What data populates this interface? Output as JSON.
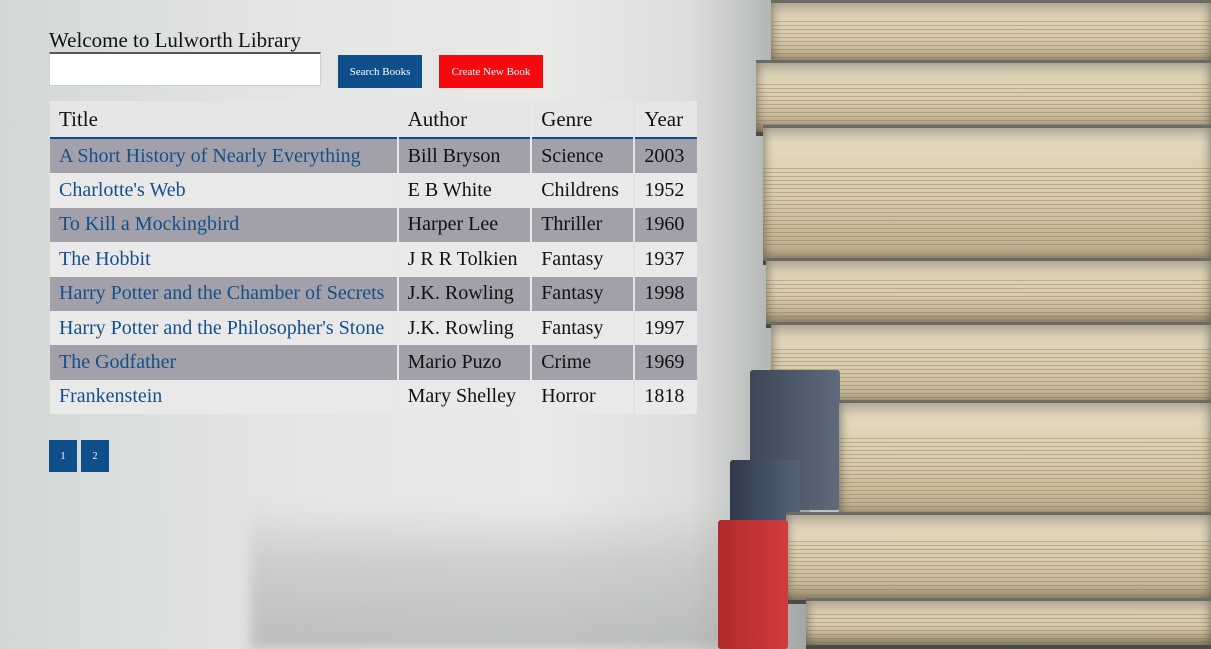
{
  "header": {
    "welcome": "Welcome to Lulworth Library"
  },
  "search": {
    "value": "",
    "placeholder": ""
  },
  "buttons": {
    "search_label": "Search Books",
    "create_label": "Create New Book"
  },
  "table": {
    "columns": [
      "Title",
      "Author",
      "Genre",
      "Year"
    ],
    "rows": [
      {
        "title": "A Short History of Nearly Everything",
        "author": "Bill Bryson",
        "genre": "Science",
        "year": "2003"
      },
      {
        "title": "Charlotte's Web",
        "author": "E B White",
        "genre": "Childrens",
        "year": "1952"
      },
      {
        "title": "To Kill a Mockingbird",
        "author": "Harper Lee",
        "genre": "Thriller",
        "year": "1960"
      },
      {
        "title": "The Hobbit",
        "author": "J R R Tolkien",
        "genre": "Fantasy",
        "year": "1937"
      },
      {
        "title": "Harry Potter and the Chamber of Secrets",
        "author": "J.K. Rowling",
        "genre": "Fantasy",
        "year": "1998"
      },
      {
        "title": "Harry Potter and the Philosopher's Stone",
        "author": "J.K. Rowling",
        "genre": "Fantasy",
        "year": "1997"
      },
      {
        "title": "The Godfather",
        "author": "Mario Puzo",
        "genre": "Crime",
        "year": "1969"
      },
      {
        "title": "Frankenstein",
        "author": "Mary Shelley",
        "genre": "Horror",
        "year": "1818"
      }
    ]
  },
  "pagination": {
    "pages": [
      "1",
      "2"
    ]
  },
  "colors": {
    "primary_button": "#0d4e8b",
    "create_button": "#f50a10",
    "link_text": "#14508c",
    "row_odd": "#a2a0a9",
    "row_even": "#e9e9e9"
  }
}
